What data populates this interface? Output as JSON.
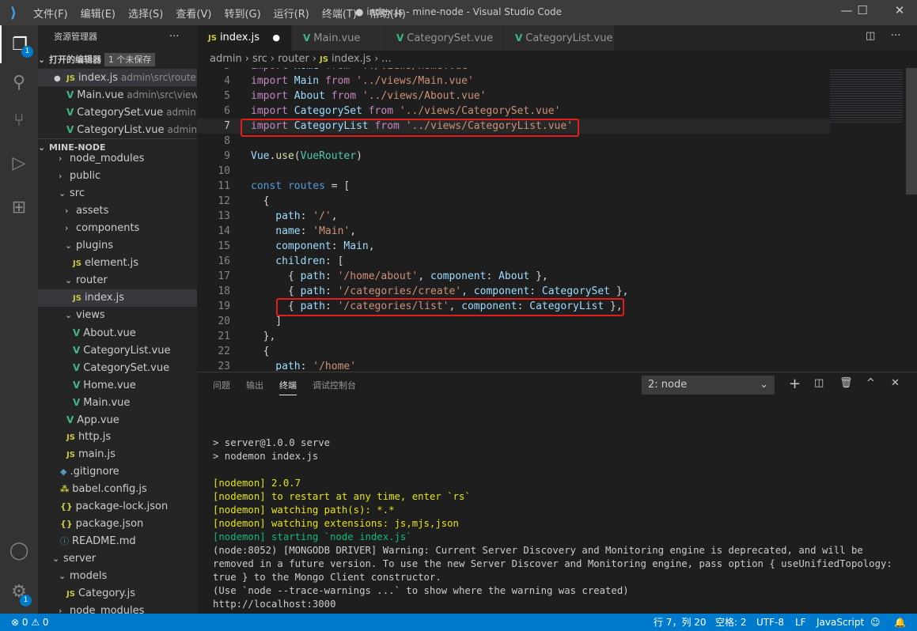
{
  "window": {
    "title": "● index.js - mine-node - Visual Studio Code",
    "menu": [
      "文件(F)",
      "编辑(E)",
      "选择(S)",
      "查看(V)",
      "转到(G)",
      "运行(R)",
      "终端(T)",
      "帮助(H)"
    ]
  },
  "activity": {
    "explorer_badge": "1",
    "settings_badge": "1"
  },
  "sidebar": {
    "title": "资源管理器",
    "more": "···",
    "open_editors": {
      "label": "打开的编辑器",
      "badge": "1 个未保存",
      "items": [
        {
          "name": "index.js",
          "path": "admin\\src\\router",
          "type": "js",
          "dirty": true
        },
        {
          "name": "Main.vue",
          "path": "admin\\src\\views",
          "type": "vue"
        },
        {
          "name": "CategorySet.vue",
          "path": "admin...",
          "type": "vue"
        },
        {
          "name": "CategoryList.vue",
          "path": "admin...",
          "type": "vue"
        }
      ]
    },
    "project": "MINE-NODE",
    "tree": [
      {
        "name": "node_modules",
        "d": 1,
        "t": "closed"
      },
      {
        "name": "public",
        "d": 1,
        "t": "closed"
      },
      {
        "name": "src",
        "d": 1,
        "t": "open"
      },
      {
        "name": "assets",
        "d": 2,
        "t": "closed"
      },
      {
        "name": "components",
        "d": 2,
        "t": "closed"
      },
      {
        "name": "plugins",
        "d": 2,
        "t": "open"
      },
      {
        "name": "element.js",
        "d": 3,
        "t": "js"
      },
      {
        "name": "router",
        "d": 2,
        "t": "open"
      },
      {
        "name": "index.js",
        "d": 3,
        "t": "js",
        "sel": true
      },
      {
        "name": "views",
        "d": 2,
        "t": "open"
      },
      {
        "name": "About.vue",
        "d": 3,
        "t": "vue"
      },
      {
        "name": "CategoryList.vue",
        "d": 3,
        "t": "vue"
      },
      {
        "name": "CategorySet.vue",
        "d": 3,
        "t": "vue"
      },
      {
        "name": "Home.vue",
        "d": 3,
        "t": "vue"
      },
      {
        "name": "Main.vue",
        "d": 3,
        "t": "vue"
      },
      {
        "name": "App.vue",
        "d": 2,
        "t": "vue"
      },
      {
        "name": "http.js",
        "d": 2,
        "t": "js"
      },
      {
        "name": "main.js",
        "d": 2,
        "t": "js"
      },
      {
        "name": ".gitignore",
        "d": 1,
        "t": "git"
      },
      {
        "name": "babel.config.js",
        "d": 1,
        "t": "babel"
      },
      {
        "name": "package-lock.json",
        "d": 1,
        "t": "json"
      },
      {
        "name": "package.json",
        "d": 1,
        "t": "json"
      },
      {
        "name": "README.md",
        "d": 1,
        "t": "md"
      },
      {
        "name": "server",
        "d": 0,
        "t": "open"
      },
      {
        "name": "models",
        "d": 1,
        "t": "open"
      },
      {
        "name": "Category.js",
        "d": 2,
        "t": "js"
      },
      {
        "name": "node_modules",
        "d": 1,
        "t": "closed"
      }
    ]
  },
  "tabs": [
    {
      "label": "index.js",
      "type": "js",
      "active": true,
      "dirty": true
    },
    {
      "label": "Main.vue",
      "type": "vue"
    },
    {
      "label": "CategorySet.vue",
      "type": "vue"
    },
    {
      "label": "CategoryList.vue",
      "type": "vue"
    }
  ],
  "breadcrumb": [
    "admin",
    "src",
    "router",
    "index.js",
    "..."
  ],
  "code": [
    {
      "n": "3",
      "t": [
        [
          "import ",
          "kw"
        ],
        [
          "Home ",
          "id"
        ],
        [
          "from ",
          "kw"
        ],
        [
          "'../views/Home.vue'",
          "st"
        ]
      ]
    },
    {
      "n": "4",
      "t": [
        [
          "import ",
          "kw"
        ],
        [
          "Main ",
          "id"
        ],
        [
          "from ",
          "kw"
        ],
        [
          "'../views/Main.vue'",
          "st"
        ]
      ]
    },
    {
      "n": "5",
      "t": [
        [
          "import ",
          "kw"
        ],
        [
          "About ",
          "id"
        ],
        [
          "from ",
          "kw"
        ],
        [
          "'../views/About.vue'",
          "st"
        ]
      ]
    },
    {
      "n": "6",
      "t": [
        [
          "import ",
          "kw"
        ],
        [
          "CategorySet ",
          "id"
        ],
        [
          "from ",
          "kw"
        ],
        [
          "'../views/CategorySet.vue'",
          "st"
        ]
      ]
    },
    {
      "n": "7",
      "t": [
        [
          "import ",
          "kw"
        ],
        [
          "CategoryList ",
          "id"
        ],
        [
          "from ",
          "kw"
        ],
        [
          "'../views/CategoryList.vue'",
          "st"
        ]
      ],
      "cur": true
    },
    {
      "n": "8",
      "t": []
    },
    {
      "n": "9",
      "t": [
        [
          "Vue",
          "id"
        ],
        [
          ".",
          "pl"
        ],
        [
          "use",
          "fn"
        ],
        [
          "(",
          "pl"
        ],
        [
          "VueRouter",
          "ty"
        ],
        [
          ")",
          "pl"
        ]
      ]
    },
    {
      "n": "10",
      "t": []
    },
    {
      "n": "11",
      "t": [
        [
          "const ",
          "bl"
        ],
        [
          "routes ",
          "bl"
        ],
        [
          "= [",
          "pl"
        ]
      ]
    },
    {
      "n": "12",
      "t": [
        [
          "  {",
          "pl"
        ]
      ]
    },
    {
      "n": "13",
      "t": [
        [
          "    path",
          "id"
        ],
        [
          ": ",
          "pl"
        ],
        [
          "'/'",
          "st"
        ],
        [
          ",",
          "pl"
        ]
      ]
    },
    {
      "n": "14",
      "t": [
        [
          "    name",
          "id"
        ],
        [
          ": ",
          "pl"
        ],
        [
          "'Main'",
          "st"
        ],
        [
          ",",
          "pl"
        ]
      ]
    },
    {
      "n": "15",
      "t": [
        [
          "    component",
          "id"
        ],
        [
          ": ",
          "pl"
        ],
        [
          "Main",
          "id"
        ],
        [
          ",",
          "pl"
        ]
      ]
    },
    {
      "n": "16",
      "t": [
        [
          "    children",
          "id"
        ],
        [
          ": [",
          "pl"
        ]
      ]
    },
    {
      "n": "17",
      "t": [
        [
          "      { ",
          "pl"
        ],
        [
          "path",
          "id"
        ],
        [
          ": ",
          "pl"
        ],
        [
          "'/home/about'",
          "st"
        ],
        [
          ", ",
          "pl"
        ],
        [
          "component",
          "id"
        ],
        [
          ": ",
          "pl"
        ],
        [
          "About",
          "id"
        ],
        [
          " },",
          "pl"
        ]
      ]
    },
    {
      "n": "18",
      "t": [
        [
          "      { ",
          "pl"
        ],
        [
          "path",
          "id"
        ],
        [
          ": ",
          "pl"
        ],
        [
          "'/categories/create'",
          "st"
        ],
        [
          ", ",
          "pl"
        ],
        [
          "component",
          "id"
        ],
        [
          ": ",
          "pl"
        ],
        [
          "CategorySet",
          "id"
        ],
        [
          " },",
          "pl"
        ]
      ]
    },
    {
      "n": "19",
      "t": [
        [
          "      { ",
          "pl"
        ],
        [
          "path",
          "id"
        ],
        [
          ": ",
          "pl"
        ],
        [
          "'/categories/list'",
          "st"
        ],
        [
          ", ",
          "pl"
        ],
        [
          "component",
          "id"
        ],
        [
          ": ",
          "pl"
        ],
        [
          "CategoryList",
          "id"
        ],
        [
          " },",
          "pl"
        ]
      ]
    },
    {
      "n": "20",
      "t": [
        [
          "    ]",
          "pl"
        ]
      ]
    },
    {
      "n": "21",
      "t": [
        [
          "  },",
          "pl"
        ]
      ]
    },
    {
      "n": "22",
      "t": [
        [
          "  {",
          "pl"
        ]
      ]
    },
    {
      "n": "23",
      "t": [
        [
          "    path",
          "id"
        ],
        [
          ": ",
          "pl"
        ],
        [
          "'/home'",
          "st"
        ]
      ]
    }
  ],
  "panel": {
    "tabs": [
      "问题",
      "输出",
      "终端",
      "调试控制台"
    ],
    "active": "终端",
    "terminal_select": "2: node",
    "terminal": [
      {
        "text": " ",
        "c": ""
      },
      {
        "text": "> server@1.0.0 serve",
        "c": ""
      },
      {
        "text": "> nodemon index.js",
        "c": ""
      },
      {
        "text": " ",
        "c": ""
      },
      {
        "text": "[nodemon] 2.0.7",
        "c": "y"
      },
      {
        "text": "[nodemon] to restart at any time, enter `rs`",
        "c": "y"
      },
      {
        "text": "[nodemon] watching path(s): *.*",
        "c": "y"
      },
      {
        "text": "[nodemon] watching extensions: js,mjs,json",
        "c": "y"
      },
      {
        "text": "[nodemon] starting `node index.js`",
        "c": "g"
      },
      {
        "text": "(node:8052) [MONGODB DRIVER] Warning: Current Server Discovery and Monitoring engine is deprecated, and will be removed in a future version. To use the new Server Discover and Monitoring engine, pass option { useUnifiedTopology: true } to the Mongo Client constructor.",
        "c": ""
      },
      {
        "text": "(Use `node --trace-warnings ...` to show where the warning was created)",
        "c": ""
      },
      {
        "text": "http://localhost:3000",
        "c": ""
      },
      {
        "text": "▯",
        "c": ""
      }
    ]
  },
  "status": {
    "errors": "0",
    "warnings": "0",
    "position": "行 7，列 20",
    "indent": "空格: 2",
    "encoding": "UTF-8",
    "eol": "LF",
    "language": "JavaScript"
  },
  "colors": {
    "statusbar": "#007acc",
    "highlight": "#e51c1c",
    "activity": "#333333",
    "sidebar": "#252526"
  }
}
